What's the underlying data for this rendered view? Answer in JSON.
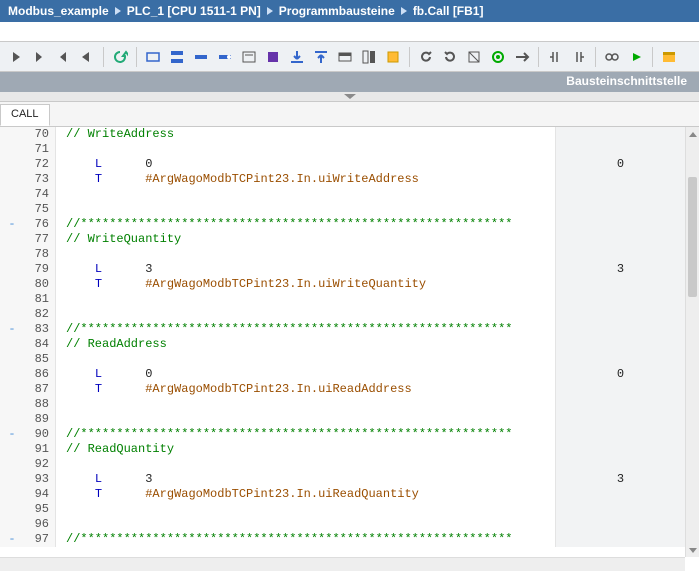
{
  "breadcrumb": {
    "items": [
      "Modbus_example",
      "PLC_1 [CPU 1511-1 PN]",
      "Programmbausteine",
      "fb.Call [FB1]"
    ]
  },
  "interface_header": "Bausteinschnittstelle",
  "tab_label": "CALL",
  "toolbar_icons": [
    "nav-first-icon",
    "nav-prev-icon",
    "nav-next-icon",
    "nav-last-icon",
    "refresh-icon",
    "network-icon",
    "rung-icon",
    "contact-icon",
    "coil-icon",
    "comment-box-icon",
    "block-icon",
    "download-icon",
    "upload-icon",
    "view-icon",
    "box-toggle-icon",
    "highlight-icon",
    "undo-icon",
    "redo-icon",
    "compile-icon",
    "monitor-icon",
    "goto-icon",
    "indent-left-icon",
    "indent-right-icon",
    "glasses-icon",
    "play-online-icon",
    "favorites-icon"
  ],
  "code": {
    "lines": [
      {
        "n": 70,
        "txt": "// WriteAddress",
        "cls": "c-comment",
        "val": ""
      },
      {
        "n": 71,
        "txt": "",
        "cls": "",
        "val": ""
      },
      {
        "n": 72,
        "txt": "    L      0",
        "cls": "mix",
        "mnem": "L",
        "arg": "0",
        "argcls": "c-num",
        "val": "0"
      },
      {
        "n": 73,
        "txt": "    T      #ArgWagoModbTCPint23.In.uiWriteAddress",
        "cls": "mix",
        "mnem": "T",
        "arg": "#ArgWagoModbTCPint23.In.uiWriteAddress",
        "argcls": "c-sym",
        "val": ""
      },
      {
        "n": 74,
        "txt": "",
        "cls": "",
        "val": ""
      },
      {
        "n": 75,
        "txt": "",
        "cls": "",
        "val": ""
      },
      {
        "n": 76,
        "txt": "//************************************************************",
        "cls": "c-comment",
        "val": "",
        "mark": "-"
      },
      {
        "n": 77,
        "txt": "// WriteQuantity",
        "cls": "c-comment",
        "val": ""
      },
      {
        "n": 78,
        "txt": "",
        "cls": "",
        "val": ""
      },
      {
        "n": 79,
        "txt": "    L      3",
        "cls": "mix",
        "mnem": "L",
        "arg": "3",
        "argcls": "c-num",
        "val": "3"
      },
      {
        "n": 80,
        "txt": "    T      #ArgWagoModbTCPint23.In.uiWriteQuantity",
        "cls": "mix",
        "mnem": "T",
        "arg": "#ArgWagoModbTCPint23.In.uiWriteQuantity",
        "argcls": "c-sym",
        "val": ""
      },
      {
        "n": 81,
        "txt": "",
        "cls": "",
        "val": ""
      },
      {
        "n": 82,
        "txt": "",
        "cls": "",
        "val": ""
      },
      {
        "n": 83,
        "txt": "//************************************************************",
        "cls": "c-comment",
        "val": "",
        "mark": "-"
      },
      {
        "n": 84,
        "txt": "// ReadAddress",
        "cls": "c-comment",
        "val": ""
      },
      {
        "n": 85,
        "txt": "",
        "cls": "",
        "val": ""
      },
      {
        "n": 86,
        "txt": "    L      0",
        "cls": "mix",
        "mnem": "L",
        "arg": "0",
        "argcls": "c-num",
        "val": "0"
      },
      {
        "n": 87,
        "txt": "    T      #ArgWagoModbTCPint23.In.uiReadAddress",
        "cls": "mix",
        "mnem": "T",
        "arg": "#ArgWagoModbTCPint23.In.uiReadAddress",
        "argcls": "c-sym",
        "val": ""
      },
      {
        "n": 88,
        "txt": "",
        "cls": "",
        "val": ""
      },
      {
        "n": 89,
        "txt": "",
        "cls": "",
        "val": ""
      },
      {
        "n": 90,
        "txt": "//************************************************************",
        "cls": "c-comment",
        "val": "",
        "mark": "-"
      },
      {
        "n": 91,
        "txt": "// ReadQuantity",
        "cls": "c-comment",
        "val": ""
      },
      {
        "n": 92,
        "txt": "",
        "cls": "",
        "val": ""
      },
      {
        "n": 93,
        "txt": "    L      3",
        "cls": "mix",
        "mnem": "L",
        "arg": "3",
        "argcls": "c-num",
        "val": "3"
      },
      {
        "n": 94,
        "txt": "    T      #ArgWagoModbTCPint23.In.uiReadQuantity",
        "cls": "mix",
        "mnem": "T",
        "arg": "#ArgWagoModbTCPint23.In.uiReadQuantity",
        "argcls": "c-sym",
        "val": ""
      },
      {
        "n": 95,
        "txt": "",
        "cls": "",
        "val": ""
      },
      {
        "n": 96,
        "txt": "",
        "cls": "",
        "val": ""
      },
      {
        "n": 97,
        "txt": "//************************************************************",
        "cls": "c-comment",
        "val": "",
        "mark": "-"
      }
    ]
  }
}
